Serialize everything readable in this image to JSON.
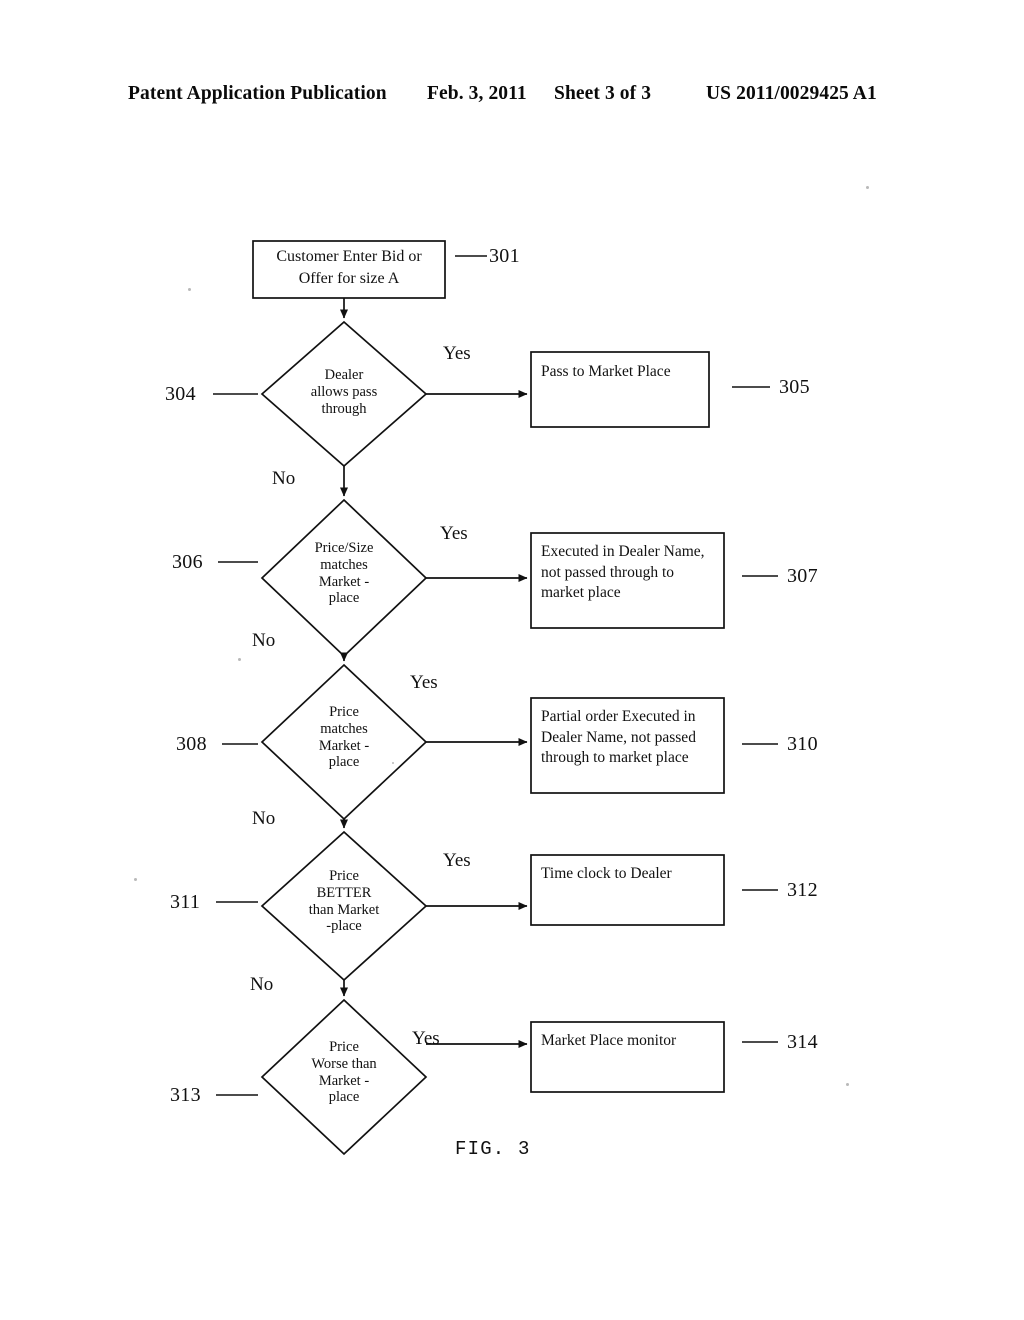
{
  "header": {
    "publication": "Patent Application Publication",
    "date": "Feb. 3, 2011",
    "sheet": "Sheet 3 of 3",
    "number": "US 2011/0029425 A1"
  },
  "figure": {
    "caption": "FIG. 3",
    "type": "flowchart",
    "line_color": "#111111",
    "background": "#ffffff"
  },
  "nodes": {
    "n301": {
      "ref": "301",
      "shape": "process",
      "text": "Customer Enter Bid or\nOffer for size A"
    },
    "n304": {
      "ref": "304",
      "shape": "decision",
      "text": "Dealer\nallows pass\nthrough"
    },
    "n305": {
      "ref": "305",
      "shape": "process",
      "text": "Pass to Market Place"
    },
    "n306": {
      "ref": "306",
      "shape": "decision",
      "text": "Price/Size\nmatches\nMarket -\nplace"
    },
    "n307": {
      "ref": "307",
      "shape": "process",
      "text": "Executed in Dealer Name,\nnot passed through to\nmarket place"
    },
    "n308": {
      "ref": "308",
      "shape": "decision",
      "text": "Price\nmatches\nMarket -\nplace"
    },
    "n310": {
      "ref": "310",
      "shape": "process",
      "text": "Partial order Executed in\nDealer Name, not passed\nthrough to market place"
    },
    "n311": {
      "ref": "311",
      "shape": "decision",
      "text": "Price\nBETTER\nthan Market\n-place"
    },
    "n312": {
      "ref": "312",
      "shape": "process",
      "text": "Time clock to Dealer"
    },
    "n313": {
      "ref": "313",
      "shape": "decision",
      "text": "Price\nWorse than\nMarket -\nplace"
    },
    "n314": {
      "ref": "314",
      "shape": "process",
      "text": "Market Place monitor"
    }
  },
  "edge_labels": {
    "yes_304": "Yes",
    "no_304": "No",
    "yes_306": "Yes",
    "no_306": "No",
    "yes_308": "Yes",
    "no_308": "No",
    "yes_311": "Yes",
    "no_311": "No",
    "yes_313": "Yes"
  }
}
